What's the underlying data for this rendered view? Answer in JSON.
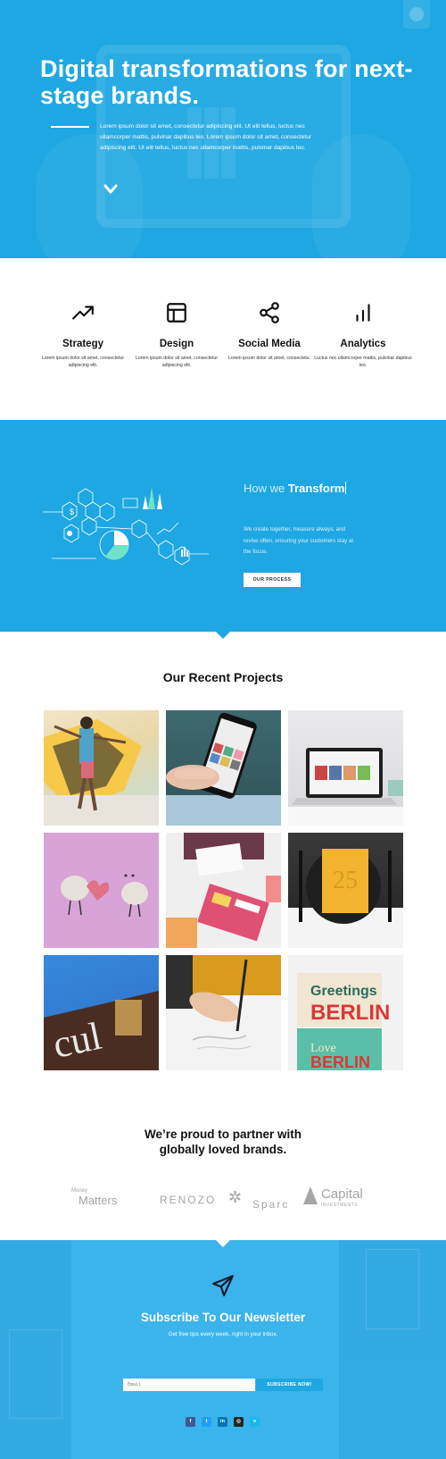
{
  "hero": {
    "title": "Digital transformations for next-stage brands.",
    "lead": "Lorem ipsum dolor sit amet, consectetur adipiscing elit. Ut elit tellus, luctus nec ullamcorper mattis, pulvinar dapibus leo. Lorem ipsum dolor sit amet, consectetur adipiscing elit. Ut elit tellus, luctus nec ullamcorper mattis, pulvinar dapibus leo.",
    "bg_color": "#1ea7e2"
  },
  "services": [
    {
      "icon": "trending-up-icon",
      "title": "Strategy",
      "text": "Lorem ipsum dolor sit amet, consectetur adipiscing elit."
    },
    {
      "icon": "layout-icon",
      "title": "Design",
      "text": "Lorem ipsum dolor sit amet, consectetur adipiscing elit."
    },
    {
      "icon": "share-icon",
      "title": "Social Media",
      "text": "Lorem ipsum dolor sit amet, consectetu."
    },
    {
      "icon": "bar-chart-icon",
      "title": "Analytics",
      "text": "Luctus nec ullamcorper mattis, pulvinar dapibus leo."
    }
  ],
  "transform": {
    "prefix": "How we ",
    "highlight": "Transform",
    "text": "We create together, measure always, and revise often, ensuring your customers stay at the focus.",
    "button": "OUR PROCESS"
  },
  "projects": {
    "title": "Our Recent Projects"
  },
  "partners": {
    "title_line1": "We’re proud to partner with",
    "title_line2": "globally loved brands.",
    "logos": [
      {
        "small": "Money",
        "name": "Matters"
      },
      {
        "name": "RENOZO"
      },
      {
        "name": "Sparc"
      },
      {
        "name": "Capital",
        "small": "INVESTMENTS"
      }
    ]
  },
  "newsletter": {
    "title": "Subscribe To Our Newsletter",
    "tips": "Get free tips every week, right in your inbox.",
    "email_placeholder": "Email",
    "button": "SUBSCRIBE NOW!",
    "socials": [
      {
        "icon": "facebook-icon",
        "glyph": "f",
        "color": "#3b5998"
      },
      {
        "icon": "twitter-icon",
        "glyph": "t",
        "color": "#1da1f2"
      },
      {
        "icon": "linkedin-icon",
        "glyph": "in",
        "color": "#0077b5"
      },
      {
        "icon": "instagram-icon",
        "glyph": "◎",
        "color": "#262626"
      },
      {
        "icon": "vimeo-icon",
        "glyph": "v",
        "color": "#1ab7ea"
      }
    ]
  }
}
